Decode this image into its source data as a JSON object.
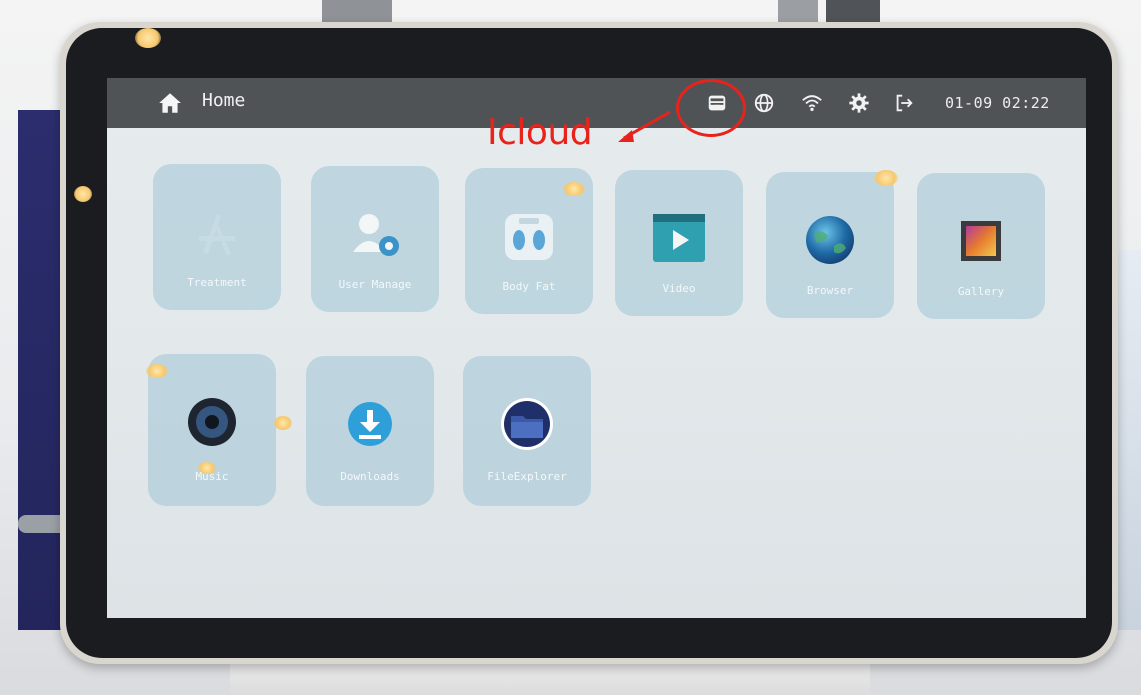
{
  "topbar": {
    "title": "Home",
    "datetime": "01-09 02:22",
    "icons": [
      "home-icon",
      "inbox-icon",
      "globe-icon",
      "wifi-icon",
      "gear-icon",
      "logout-icon"
    ]
  },
  "annotation": {
    "text": "Icloud",
    "color": "#e8231b"
  },
  "apps": [
    {
      "label": "Treatment",
      "icon": "treatment-icon"
    },
    {
      "label": "User Manage",
      "icon": "user-manage-icon"
    },
    {
      "label": "Body Fat",
      "icon": "scale-icon"
    },
    {
      "label": "Video",
      "icon": "video-icon"
    },
    {
      "label": "Browser",
      "icon": "globe-earth-icon"
    },
    {
      "label": "Gallery",
      "icon": "gallery-icon"
    },
    {
      "label": "Music",
      "icon": "speaker-icon"
    },
    {
      "label": "Downloads",
      "icon": "download-icon"
    },
    {
      "label": "FileExplorer",
      "icon": "folder-icon"
    }
  ],
  "colors": {
    "topbar": "#505356",
    "tile": "#a0c4d6",
    "accent": "#2f9fd9"
  }
}
